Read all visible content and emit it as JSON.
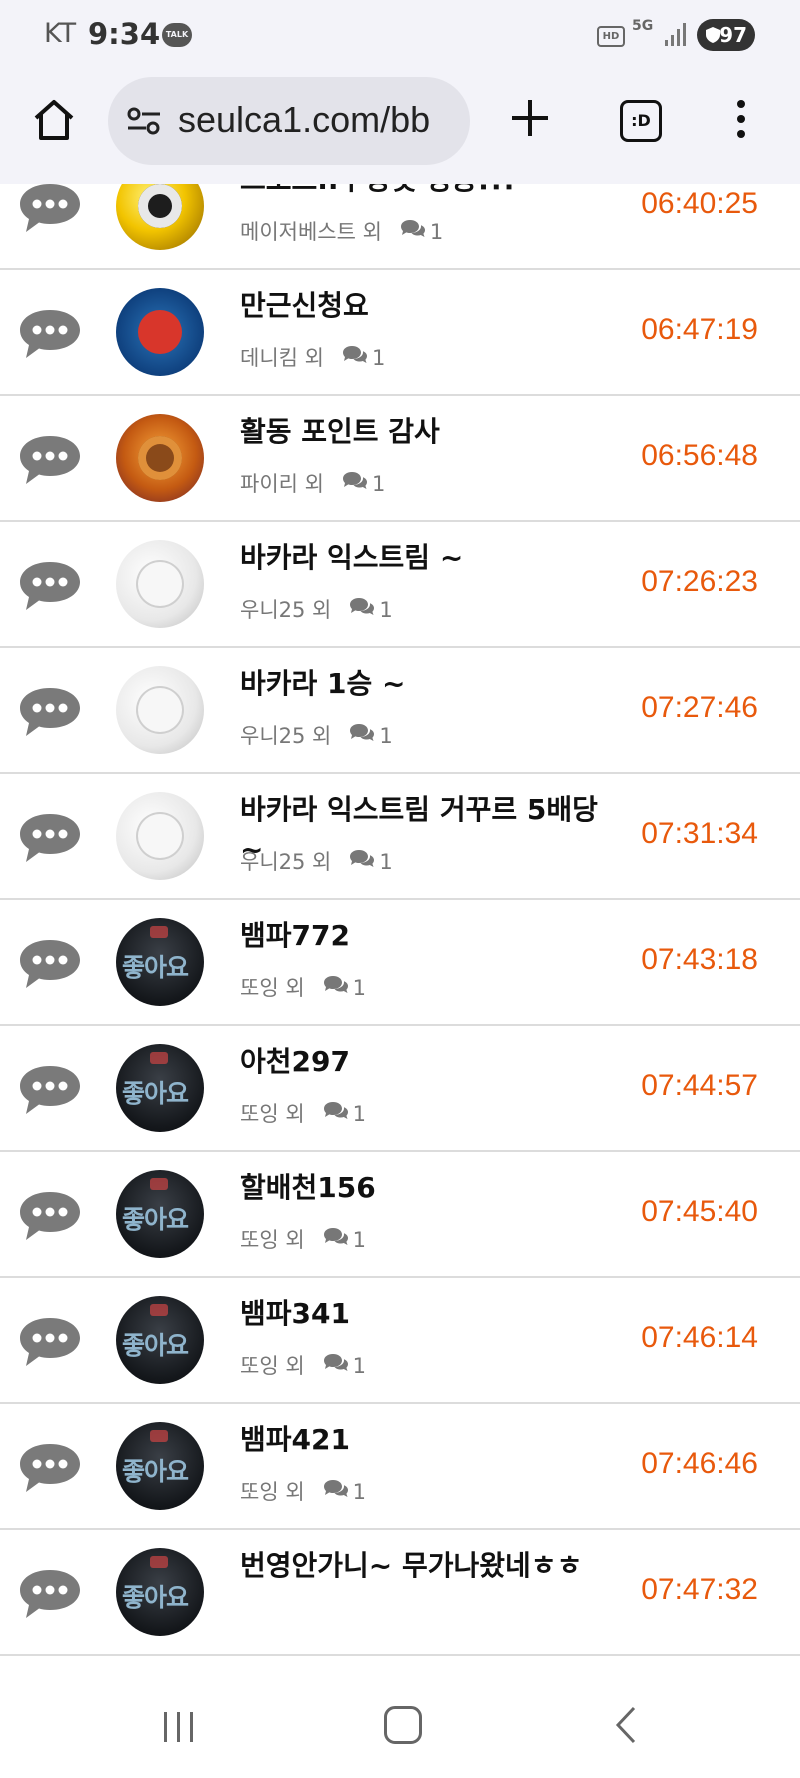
{
  "status_bar": {
    "carrier": "KT",
    "time": "9:34",
    "talk_badge": "TALK",
    "hd": "HD",
    "network": "5G",
    "battery": "97"
  },
  "browser": {
    "url": "seulca1.com/bb",
    "tabs_label": ":D"
  },
  "items": [
    {
      "title": "스포츠..루징벳 성공!!!",
      "author": "메이저베스트 외",
      "comments": "1",
      "time": "06:40:25",
      "avatar": "gold"
    },
    {
      "title": "만근신청요",
      "author": "데니킴 외",
      "comments": "1",
      "time": "06:47:19",
      "avatar": "blue"
    },
    {
      "title": "활동 포인트 감사",
      "author": "파이리 외",
      "comments": "1",
      "time": "06:56:48",
      "avatar": "orange"
    },
    {
      "title": "바카라 익스트림 ~",
      "author": "우니25 외",
      "comments": "1",
      "time": "07:26:23",
      "avatar": "white"
    },
    {
      "title": "바카라 1승 ~",
      "author": "우니25 외",
      "comments": "1",
      "time": "07:27:46",
      "avatar": "white"
    },
    {
      "title": "바카라 익스트림 거꾸르 5배당 ~",
      "author": "우니25 외",
      "comments": "1",
      "time": "07:31:34",
      "avatar": "white"
    },
    {
      "title": "뱀파772",
      "author": "또잉 외",
      "comments": "1",
      "time": "07:43:18",
      "avatar": "dark"
    },
    {
      "title": "아천297",
      "author": "또잉 외",
      "comments": "1",
      "time": "07:44:57",
      "avatar": "dark"
    },
    {
      "title": "할배천156",
      "author": "또잉 외",
      "comments": "1",
      "time": "07:45:40",
      "avatar": "dark"
    },
    {
      "title": "뱀파341",
      "author": "또잉 외",
      "comments": "1",
      "time": "07:46:14",
      "avatar": "dark"
    },
    {
      "title": "뱀파421",
      "author": "또잉 외",
      "comments": "1",
      "time": "07:46:46",
      "avatar": "dark"
    },
    {
      "title": "번영안가니~ 무가나왔네ㅎㅎ",
      "author": "",
      "comments": "",
      "time": "07:47:32",
      "avatar": "dark"
    }
  ],
  "avatar_text": "좋아요",
  "colors": {
    "time": "#e8590c",
    "chrome_bg": "#f3f3f9",
    "url_pill": "#e3e3ea",
    "divider": "#dcdcdc"
  },
  "icons": [
    "home-icon",
    "site-settings-icon",
    "new-tab-icon",
    "tab-switcher-icon",
    "more-menu-icon",
    "speech-bubble-icon",
    "comments-icon",
    "recent-apps-icon",
    "home-nav-icon",
    "back-icon"
  ]
}
